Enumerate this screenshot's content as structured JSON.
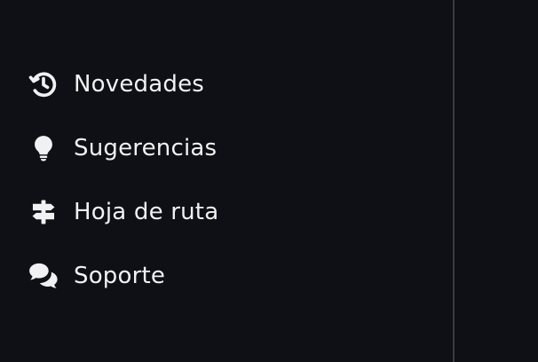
{
  "menu": {
    "items": [
      {
        "label": "Novedades",
        "icon": "history-icon"
      },
      {
        "label": "Sugerencias",
        "icon": "lightbulb-icon"
      },
      {
        "label": "Hoja de ruta",
        "icon": "signpost-icon"
      },
      {
        "label": "Soporte",
        "icon": "chat-bubbles-icon"
      }
    ]
  },
  "colors": {
    "background": "#0f1015",
    "text": "#f1f1f3",
    "divider": "#3b3c42"
  }
}
